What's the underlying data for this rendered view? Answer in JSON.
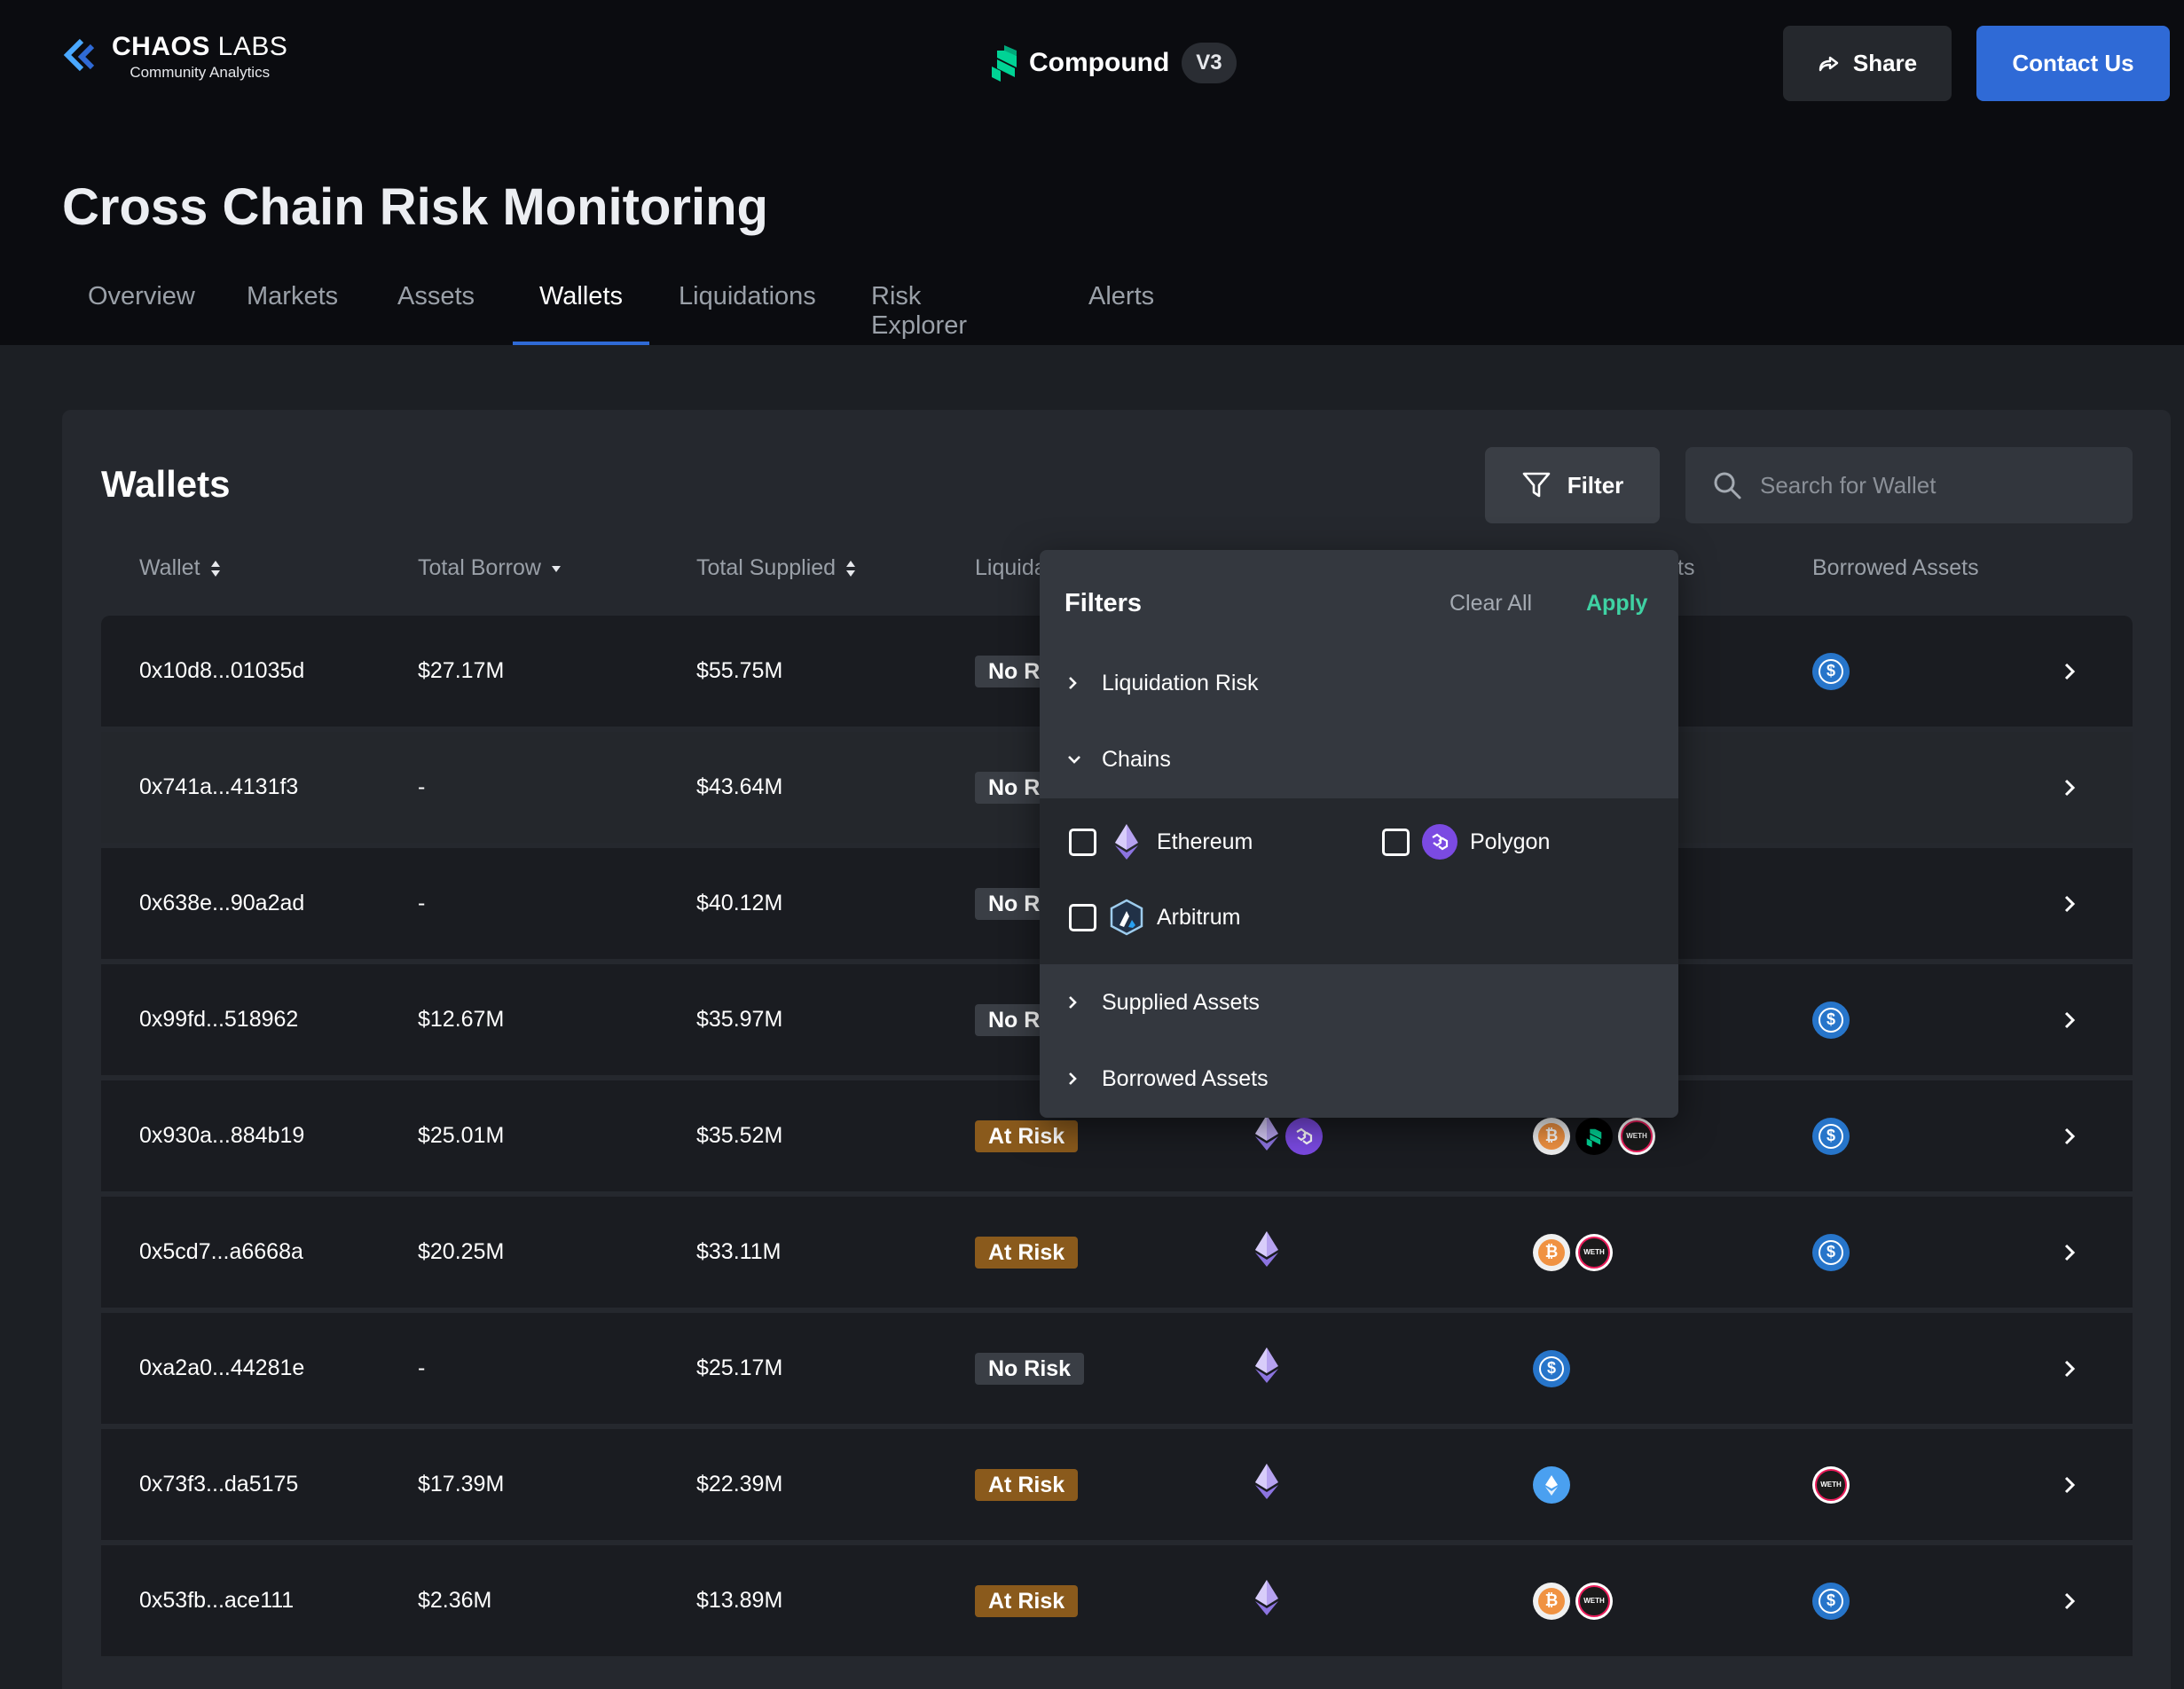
{
  "brand": {
    "name_bold": "CHAOS",
    "name_light": " LABS",
    "subtitle": "Community Analytics"
  },
  "product": {
    "name": "Compound",
    "version": "V3"
  },
  "header": {
    "share_label": "Share",
    "contact_label": "Contact Us"
  },
  "page": {
    "title": "Cross Chain Risk Monitoring"
  },
  "tabs": [
    {
      "label": "Overview",
      "active": false
    },
    {
      "label": "Markets",
      "active": false
    },
    {
      "label": "Assets",
      "active": false
    },
    {
      "label": "Wallets",
      "active": true
    },
    {
      "label": "Liquidations",
      "active": false
    },
    {
      "label": "Risk Explorer",
      "active": false
    },
    {
      "label": "Alerts",
      "active": false
    }
  ],
  "wallets": {
    "title": "Wallets",
    "filter_label": "Filter",
    "search_placeholder": "Search for Wallet",
    "columns": {
      "wallet": "Wallet",
      "total_borrow": "Total Borrow",
      "total_supplied": "Total Supplied",
      "liquidation_risk_visible": "Liquida",
      "supplied_assets_visible": "ts",
      "borrowed_assets": "Borrowed Assets"
    },
    "rows": [
      {
        "wallet": "0x10d8...01035d",
        "borrow": "$27.17M",
        "supplied": "$55.75M",
        "risk": "No R",
        "risk_type": "no",
        "chains": [],
        "supplied_assets": [],
        "borrowed_assets": [
          "usdc"
        ]
      },
      {
        "wallet": "0x741a...4131f3",
        "borrow": "-",
        "supplied": "$43.64M",
        "risk": "No R",
        "risk_type": "no",
        "chains": [],
        "supplied_assets": [],
        "borrowed_assets": []
      },
      {
        "wallet": "0x638e...90a2ad",
        "borrow": "-",
        "supplied": "$40.12M",
        "risk": "No R",
        "risk_type": "no",
        "chains": [],
        "supplied_assets": [],
        "borrowed_assets": []
      },
      {
        "wallet": "0x99fd...518962",
        "borrow": "$12.67M",
        "supplied": "$35.97M",
        "risk": "No R",
        "risk_type": "no",
        "chains": [],
        "supplied_assets": [],
        "borrowed_assets": [
          "usdc"
        ]
      },
      {
        "wallet": "0x930a...884b19",
        "borrow": "$25.01M",
        "supplied": "$35.52M",
        "risk": "At Risk",
        "risk_type": "risk",
        "chains": [
          "eth",
          "matic"
        ],
        "supplied_assets": [
          "wbtc",
          "comp",
          "weth"
        ],
        "borrowed_assets": [
          "usdc"
        ]
      },
      {
        "wallet": "0x5cd7...a6668a",
        "borrow": "$20.25M",
        "supplied": "$33.11M",
        "risk": "At Risk",
        "risk_type": "risk",
        "chains": [
          "eth"
        ],
        "supplied_assets": [
          "wbtc",
          "weth"
        ],
        "borrowed_assets": [
          "usdc"
        ]
      },
      {
        "wallet": "0xa2a0...44281e",
        "borrow": "-",
        "supplied": "$25.17M",
        "risk": "No Risk",
        "risk_type": "no",
        "chains": [
          "eth"
        ],
        "supplied_assets": [
          "usdc"
        ],
        "borrowed_assets": []
      },
      {
        "wallet": "0x73f3...da5175",
        "borrow": "$17.39M",
        "supplied": "$22.39M",
        "risk": "At Risk",
        "risk_type": "risk",
        "chains": [
          "eth"
        ],
        "supplied_assets": [
          "steth"
        ],
        "borrowed_assets": [
          "weth"
        ]
      },
      {
        "wallet": "0x53fb...ace111",
        "borrow": "$2.36M",
        "supplied": "$13.89M",
        "risk": "At Risk",
        "risk_type": "risk",
        "chains": [
          "eth"
        ],
        "supplied_assets": [
          "wbtc",
          "weth"
        ],
        "borrowed_assets": [
          "usdc"
        ]
      }
    ]
  },
  "filters": {
    "title": "Filters",
    "clear_label": "Clear All",
    "apply_label": "Apply",
    "sections": {
      "liquidation_risk": "Liquidation Risk",
      "chains": "Chains",
      "supplied_assets": "Supplied Assets",
      "borrowed_assets": "Borrowed Assets"
    },
    "chain_options": {
      "ethereum": "Ethereum",
      "polygon": "Polygon",
      "arbitrum": "Arbitrum"
    }
  },
  "icons": {
    "share": "share-icon",
    "filter": "funnel-icon",
    "search": "search-icon",
    "chevron_right": "chevron-right-icon",
    "chevron_down": "chevron-down-icon"
  },
  "colors": {
    "accent": "#2f6ad6",
    "apply": "#3fd2a3",
    "at_risk": "#8a5a1c",
    "compound_green": "#00d395"
  }
}
